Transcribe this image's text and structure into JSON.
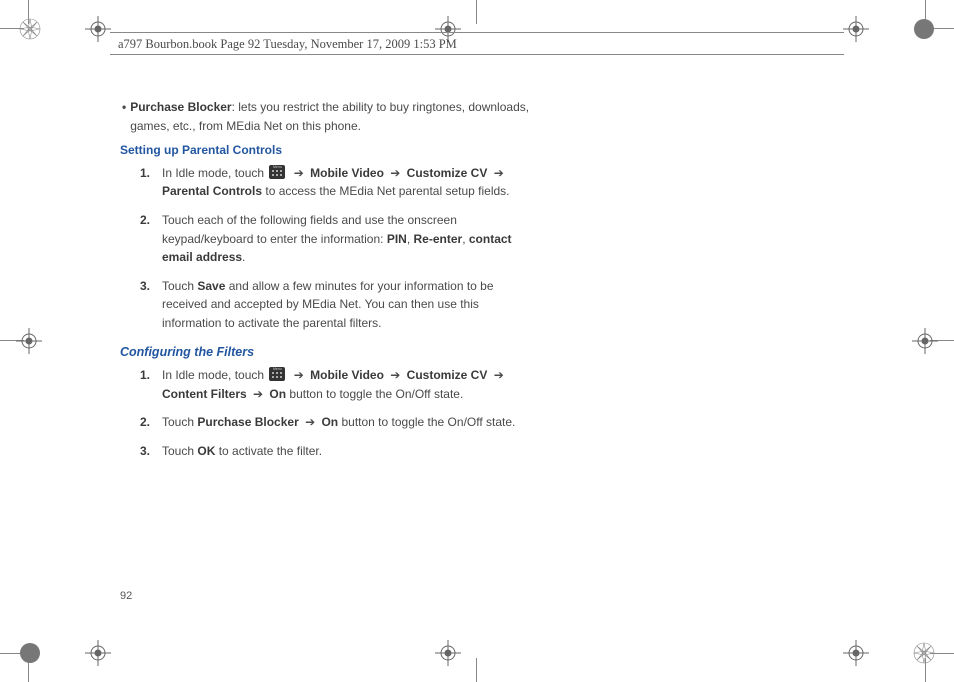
{
  "header": "a797 Bourbon.book  Page 92  Tuesday, November 17, 2009  1:53 PM",
  "page_number": "92",
  "bullet": {
    "title": "Purchase Blocker",
    "text": ": lets you restrict the ability to buy ringtones, downloads, games, etc., from MEdia Net on this phone."
  },
  "heading1": "Setting up Parental Controls",
  "steps1": [
    {
      "num": "1.",
      "pre": "In Idle mode, touch ",
      "arrow": " ➔ ",
      "b1": "Mobile Video",
      "b2": "Customize CV",
      "b3": "Parental Controls",
      "post": " to access the MEdia Net parental setup fields."
    },
    {
      "num": "2.",
      "pre": "Touch each of the following fields and use the onscreen keypad/keyboard to enter the information: ",
      "b1": "PIN",
      "sep1": ", ",
      "b2": "Re-enter",
      "sep2": ", ",
      "b3": "contact email address",
      "post": "."
    },
    {
      "num": "3.",
      "pre": "Touch ",
      "b1": "Save",
      "post": " and allow a few minutes for your information to be received and accepted by MEdia Net. You can then use this information to activate the parental filters."
    }
  ],
  "heading2": "Configuring the Filters",
  "steps2": [
    {
      "num": "1.",
      "pre": "In Idle mode, touch ",
      "arrow": " ➔ ",
      "b1": "Mobile Video",
      "b2": "Customize CV",
      "b3": "Content Filters",
      "b4": "On",
      "post": " button to toggle the On/Off state."
    },
    {
      "num": "2.",
      "pre": "Touch ",
      "b1": "Purchase Blocker ",
      "arrow": " ➔ ",
      "b2": "On",
      "post": " button to toggle the On/Off state."
    },
    {
      "num": "3.",
      "pre": "Touch ",
      "b1": "OK",
      "post": " to activate the filter."
    }
  ]
}
